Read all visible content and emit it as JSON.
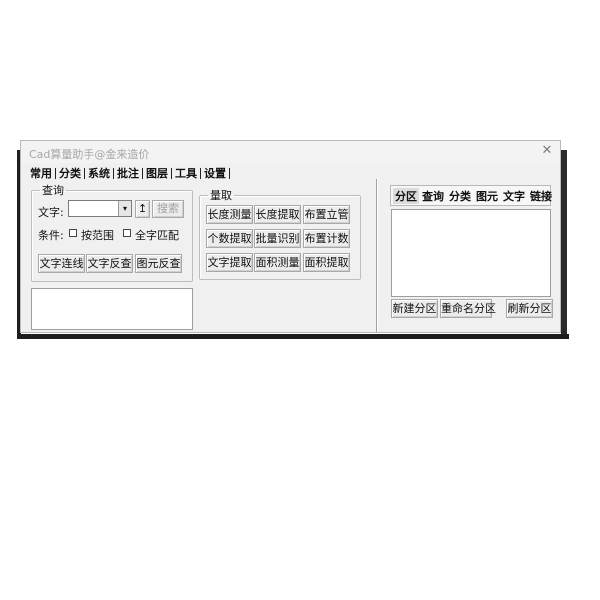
{
  "window": {
    "title": "Cad算量助手@金来造价",
    "close_glyph": "✕"
  },
  "menu": [
    "常用",
    "分类",
    "系统",
    "批注",
    "图层",
    "工具",
    "设置"
  ],
  "query": {
    "legend": "查询",
    "text_label": "文字:",
    "text_value": "",
    "dropdown_glyph": "▾",
    "pin_glyph": "↥",
    "search_label": "搜索",
    "condition_label": "条件:",
    "option_range": "按范围",
    "option_full_match": "全字匹配",
    "btn_text_link": "文字连线",
    "btn_text_reverse": "文字反查",
    "btn_element_reverse": "图元反查"
  },
  "measure": {
    "legend": "量取",
    "buttons": [
      "长度测量",
      "长度提取",
      "布置立管",
      "个数提取",
      "批量识别",
      "布置计数",
      "文字提取",
      "面积测量",
      "面积提取"
    ]
  },
  "right_panel": {
    "tabs": [
      "分区",
      "查询",
      "分类",
      "图元",
      "文字",
      "链接"
    ],
    "active_tab": "分区",
    "btn_new": "新建分区",
    "btn_rename": "重命名分区",
    "btn_refresh": "刷新分区"
  }
}
